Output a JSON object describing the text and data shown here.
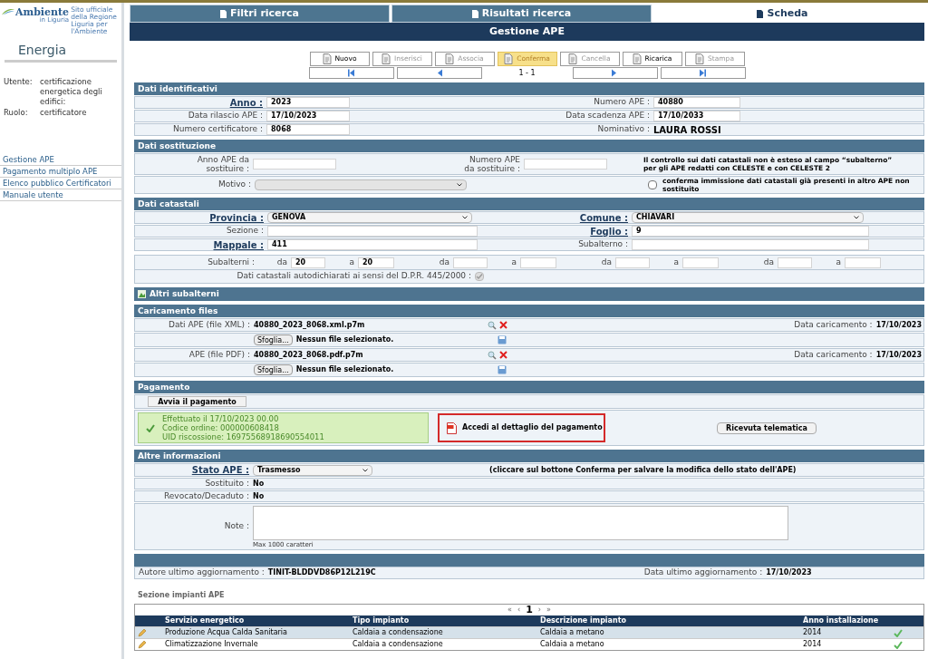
{
  "sidebar": {
    "brand": "Ambiente",
    "brand_sub": "in Liguria",
    "tagline": "Sito ufficiale della Regione Liguria per l'Ambiente",
    "title": "Energia",
    "user": [
      {
        "label": "Utente:",
        "value": "certificazione energetica degli edifici:"
      },
      {
        "label": "Ruolo:",
        "value": "certificatore"
      }
    ],
    "menu": [
      "Gestione APE",
      "Pagamento multiplo APE",
      "Elenco pubblico Certificatori",
      "Manuale utente"
    ]
  },
  "tabs": [
    {
      "label": "Filtri ricerca",
      "selected": false
    },
    {
      "label": "Risultati ricerca",
      "selected": false
    },
    {
      "label": "Scheda",
      "selected": true
    }
  ],
  "page_title": "Gestione APE",
  "toolbar": [
    {
      "label": "Nuovo",
      "disabled": false,
      "highlighted": false
    },
    {
      "label": "Inserisci",
      "disabled": true,
      "highlighted": false
    },
    {
      "label": "Associa",
      "disabled": true,
      "highlighted": false
    },
    {
      "label": "Conferma",
      "disabled": false,
      "highlighted": true
    },
    {
      "label": "Cancella",
      "disabled": true,
      "highlighted": false
    },
    {
      "label": "Ricarica",
      "disabled": false,
      "highlighted": false
    },
    {
      "label": "Stampa",
      "disabled": true,
      "highlighted": false
    }
  ],
  "pager": "1 - 1",
  "identificativi": {
    "title": "Dati identificativi",
    "rows": [
      [
        {
          "label": "Anno :",
          "value": "2023",
          "underlined": true,
          "kind": "input"
        },
        {
          "label": "Numero APE :",
          "value": "40880",
          "underlined": false,
          "kind": "input"
        }
      ],
      [
        {
          "label": "Data rilascio APE :",
          "value": "17/10/2023",
          "underlined": false,
          "kind": "input"
        },
        {
          "label": "Data scadenza APE :",
          "value": "17/10/2033",
          "underlined": false,
          "kind": "input"
        }
      ],
      [
        {
          "label": "Numero certificatore :",
          "value": "8068",
          "underlined": false,
          "kind": "input"
        },
        {
          "label": "Nominativo :",
          "value": "LAURA ROSSI",
          "underlined": false,
          "kind": "text"
        }
      ]
    ]
  },
  "sostituzione": {
    "title": "Dati sostituzione",
    "anno_label": "Anno APE da sostituire :",
    "numero_label": "Numero APE da sostituire :",
    "note": "Il controllo sui dati catastali non è esteso al campo “subalterno” per gli APE redatti con CELESTE e con CELESTE 2",
    "motivo_label": "Motivo :",
    "motivo_disabled": true,
    "conferma": {
      "label": "conferma immissione dati catastali già presenti in altro APE non sostituito",
      "checked": false
    }
  },
  "catastali": {
    "title": "Dati catastali",
    "rows": [
      [
        {
          "label": "Provincia :",
          "value": "GENOVA",
          "underlined": true,
          "kind": "select"
        },
        {
          "label": "Comune :",
          "value": "CHIAVARI",
          "underlined": true,
          "kind": "select"
        }
      ],
      [
        {
          "label": "Sezione :",
          "underlined": false,
          "kind": "input"
        },
        {
          "label": "Foglio :",
          "value": "9",
          "underlined": true,
          "kind": "input"
        }
      ],
      [
        {
          "label": "Mappale :",
          "value": "411",
          "underlined": true,
          "kind": "input"
        },
        {
          "label": "Subalterno :",
          "underlined": false,
          "kind": "input"
        }
      ]
    ],
    "subalterni_label": "Subalterni :",
    "subalterni": [
      {
        "da_label": "da",
        "da": "20",
        "a_label": "a",
        "a": "20"
      },
      {
        "da_label": "da",
        "a_label": "a"
      },
      {
        "da_label": "da",
        "a_label": "a"
      },
      {
        "da_label": "da",
        "a_label": "a"
      }
    ],
    "autodichiarati": {
      "label": "Dati catastali autodichiarati ai sensi del D.P.R. 445/2000 :",
      "checked": true,
      "disabled": true
    }
  },
  "altri_subalterni": "Altri subalterni",
  "files": {
    "title": "Caricamento files",
    "items": [
      {
        "label": "Dati APE (file XML) :",
        "filename": "40880_2023_8068.xml.p7m",
        "date_label": "Data caricamento :",
        "date": "17/10/2023",
        "browse": "Sfoglia...",
        "status": "Nessun file selezionato."
      },
      {
        "label": "APE (file PDF) :",
        "filename": "40880_2023_8068.pdf.p7m",
        "date_label": "Data caricamento :",
        "date": "17/10/2023",
        "browse": "Sfoglia...",
        "status": "Nessun file selezionato."
      }
    ]
  },
  "pagamento": {
    "title": "Pagamento",
    "start_button": "Avvia il pagamento",
    "receipt": [
      "Effettuato il 17/10/2023 00.00",
      "Codice ordine: 000000608418",
      "UID riscossione: 16975568918690554011"
    ],
    "detail_link": "Accedi al dettaglio del pagamento",
    "telematic_button": "Ricevuta telematica"
  },
  "altre": {
    "title": "Altre informazioni",
    "stato_label": "Stato APE :",
    "stato": "Trasmesso",
    "stato_hint": "(cliccare sul bottone Conferma per salvare la modifica dello stato dell'APE)",
    "rows": [
      {
        "label": "Sostituito :",
        "value": "No"
      },
      {
        "label": "Revocato/Decaduto :",
        "value": "No"
      }
    ],
    "note_label": "Note :",
    "note_hint": "Max 1000 caratteri"
  },
  "aggiornamento": {
    "author_label": "Autore ultimo aggiornamento :",
    "author": "TINIT-BLDDVD86P12L219C",
    "date_label": "Data ultimo aggiornamento :",
    "date": "17/10/2023"
  },
  "impianti": {
    "title": "Sezione impianti APE",
    "pager": {
      "first": "«",
      "prev": "‹",
      "page": "1",
      "next": "›",
      "last": "»"
    },
    "columns": [
      "Servizio energetico",
      "Tipo impianto",
      "Descrizione impianto",
      "Anno installazione"
    ],
    "rows": [
      {
        "cells": [
          "Produzione Acqua Calda Sanitaria",
          "Caldaia a condensazione",
          "Caldaia a metano",
          "2014"
        ],
        "selected": true
      },
      {
        "cells": [
          "Climatizzazione Invernale",
          "Caldaia a condensazione",
          "Caldaia a metano",
          "2014"
        ],
        "selected": false
      }
    ]
  }
}
